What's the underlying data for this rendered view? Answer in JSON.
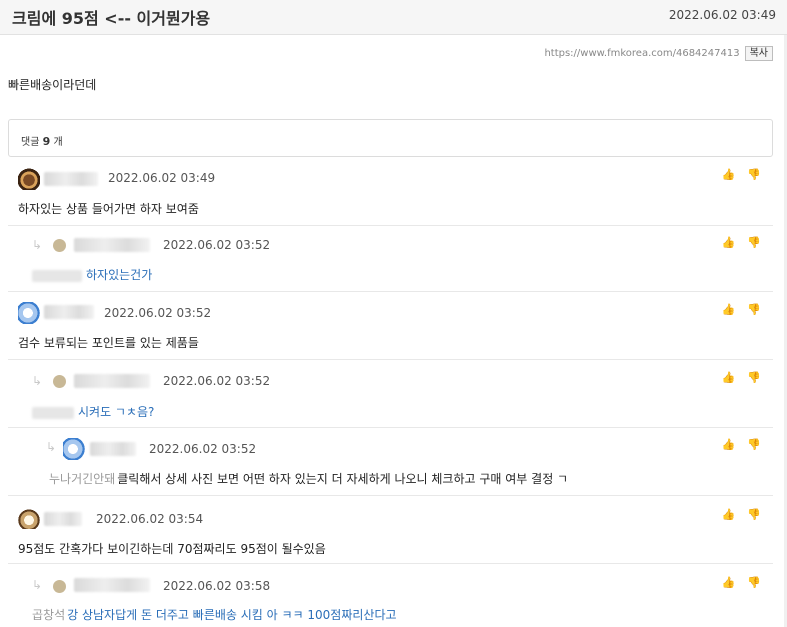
{
  "post": {
    "title": "크림에 95점 <-- 이거뭔가용",
    "date": "2022.06.02 03:49",
    "url": "https://www.fmkorea.com/4684247413",
    "copy_label": "복사",
    "body": "빠른배송이라던데"
  },
  "comment_count": {
    "prefix": "댓글",
    "count": "9",
    "suffix": "개"
  },
  "comments": [
    {
      "date": "2022.06.02 03:49",
      "text": "하자있는 상품 들어가면 하자 보여줌",
      "avatar": "bear-icon"
    },
    {
      "date": "2022.06.02 03:52",
      "text": "하자있는건가",
      "avatar": "default-avatar-icon"
    },
    {
      "date": "2022.06.02 03:52",
      "text": "검수 보류되는 포인트를 있는 제품들",
      "avatar": "ghost-icon"
    },
    {
      "date": "2022.06.02 03:52",
      "text": "시켜도 ㄱㅊ음?",
      "avatar": "default-avatar-icon"
    },
    {
      "date": "2022.06.02 03:52",
      "mention": "누나거긴안돼",
      "text": "클릭해서 상세 사진 보면 어떤 하자 있는지 더 자세하게 나오니 체크하고 구매 여부 결정 ㄱ",
      "avatar": "ghost-icon"
    },
    {
      "date": "2022.06.02 03:54",
      "text": "95점도 간혹가다 보이긴하는데 70점짜리도 95점이 될수있음",
      "avatar": "dog-icon"
    },
    {
      "date": "2022.06.02 03:58",
      "mention": "곱창석",
      "text": "강 상남자답게 돈 더주고 빠른배송 시킴 아 ㅋㅋ 100점짜리산다고",
      "avatar": "default-avatar-icon"
    }
  ],
  "icons": {
    "upvote": "thumbs-up-icon",
    "downvote": "thumbs-down-icon",
    "reply": "reply-arrow-icon"
  }
}
